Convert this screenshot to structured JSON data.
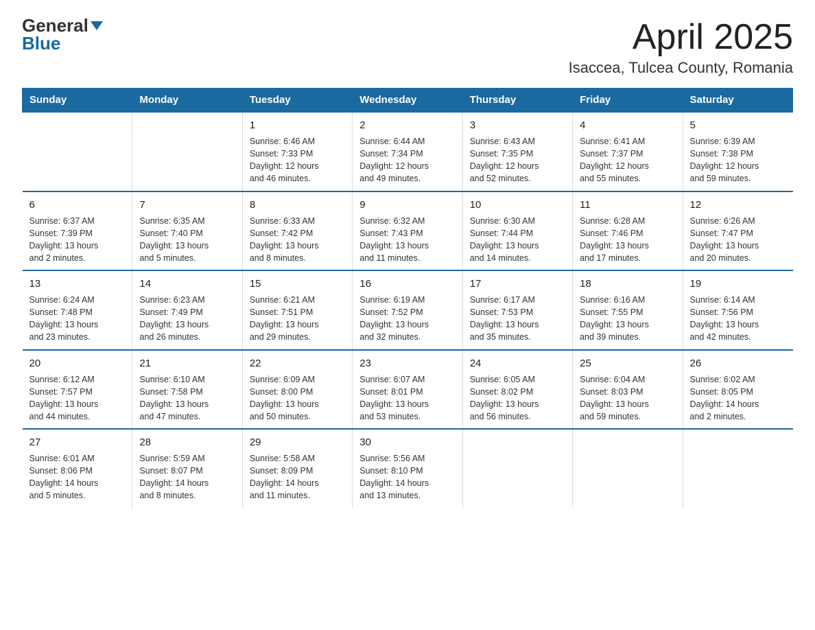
{
  "header": {
    "logo_line1": "General",
    "logo_line2": "Blue",
    "month_year": "April 2025",
    "location": "Isaccea, Tulcea County, Romania"
  },
  "days_of_week": [
    "Sunday",
    "Monday",
    "Tuesday",
    "Wednesday",
    "Thursday",
    "Friday",
    "Saturday"
  ],
  "weeks": [
    [
      {
        "day": "",
        "info": ""
      },
      {
        "day": "",
        "info": ""
      },
      {
        "day": "1",
        "info": "Sunrise: 6:46 AM\nSunset: 7:33 PM\nDaylight: 12 hours\nand 46 minutes."
      },
      {
        "day": "2",
        "info": "Sunrise: 6:44 AM\nSunset: 7:34 PM\nDaylight: 12 hours\nand 49 minutes."
      },
      {
        "day": "3",
        "info": "Sunrise: 6:43 AM\nSunset: 7:35 PM\nDaylight: 12 hours\nand 52 minutes."
      },
      {
        "day": "4",
        "info": "Sunrise: 6:41 AM\nSunset: 7:37 PM\nDaylight: 12 hours\nand 55 minutes."
      },
      {
        "day": "5",
        "info": "Sunrise: 6:39 AM\nSunset: 7:38 PM\nDaylight: 12 hours\nand 59 minutes."
      }
    ],
    [
      {
        "day": "6",
        "info": "Sunrise: 6:37 AM\nSunset: 7:39 PM\nDaylight: 13 hours\nand 2 minutes."
      },
      {
        "day": "7",
        "info": "Sunrise: 6:35 AM\nSunset: 7:40 PM\nDaylight: 13 hours\nand 5 minutes."
      },
      {
        "day": "8",
        "info": "Sunrise: 6:33 AM\nSunset: 7:42 PM\nDaylight: 13 hours\nand 8 minutes."
      },
      {
        "day": "9",
        "info": "Sunrise: 6:32 AM\nSunset: 7:43 PM\nDaylight: 13 hours\nand 11 minutes."
      },
      {
        "day": "10",
        "info": "Sunrise: 6:30 AM\nSunset: 7:44 PM\nDaylight: 13 hours\nand 14 minutes."
      },
      {
        "day": "11",
        "info": "Sunrise: 6:28 AM\nSunset: 7:46 PM\nDaylight: 13 hours\nand 17 minutes."
      },
      {
        "day": "12",
        "info": "Sunrise: 6:26 AM\nSunset: 7:47 PM\nDaylight: 13 hours\nand 20 minutes."
      }
    ],
    [
      {
        "day": "13",
        "info": "Sunrise: 6:24 AM\nSunset: 7:48 PM\nDaylight: 13 hours\nand 23 minutes."
      },
      {
        "day": "14",
        "info": "Sunrise: 6:23 AM\nSunset: 7:49 PM\nDaylight: 13 hours\nand 26 minutes."
      },
      {
        "day": "15",
        "info": "Sunrise: 6:21 AM\nSunset: 7:51 PM\nDaylight: 13 hours\nand 29 minutes."
      },
      {
        "day": "16",
        "info": "Sunrise: 6:19 AM\nSunset: 7:52 PM\nDaylight: 13 hours\nand 32 minutes."
      },
      {
        "day": "17",
        "info": "Sunrise: 6:17 AM\nSunset: 7:53 PM\nDaylight: 13 hours\nand 35 minutes."
      },
      {
        "day": "18",
        "info": "Sunrise: 6:16 AM\nSunset: 7:55 PM\nDaylight: 13 hours\nand 39 minutes."
      },
      {
        "day": "19",
        "info": "Sunrise: 6:14 AM\nSunset: 7:56 PM\nDaylight: 13 hours\nand 42 minutes."
      }
    ],
    [
      {
        "day": "20",
        "info": "Sunrise: 6:12 AM\nSunset: 7:57 PM\nDaylight: 13 hours\nand 44 minutes."
      },
      {
        "day": "21",
        "info": "Sunrise: 6:10 AM\nSunset: 7:58 PM\nDaylight: 13 hours\nand 47 minutes."
      },
      {
        "day": "22",
        "info": "Sunrise: 6:09 AM\nSunset: 8:00 PM\nDaylight: 13 hours\nand 50 minutes."
      },
      {
        "day": "23",
        "info": "Sunrise: 6:07 AM\nSunset: 8:01 PM\nDaylight: 13 hours\nand 53 minutes."
      },
      {
        "day": "24",
        "info": "Sunrise: 6:05 AM\nSunset: 8:02 PM\nDaylight: 13 hours\nand 56 minutes."
      },
      {
        "day": "25",
        "info": "Sunrise: 6:04 AM\nSunset: 8:03 PM\nDaylight: 13 hours\nand 59 minutes."
      },
      {
        "day": "26",
        "info": "Sunrise: 6:02 AM\nSunset: 8:05 PM\nDaylight: 14 hours\nand 2 minutes."
      }
    ],
    [
      {
        "day": "27",
        "info": "Sunrise: 6:01 AM\nSunset: 8:06 PM\nDaylight: 14 hours\nand 5 minutes."
      },
      {
        "day": "28",
        "info": "Sunrise: 5:59 AM\nSunset: 8:07 PM\nDaylight: 14 hours\nand 8 minutes."
      },
      {
        "day": "29",
        "info": "Sunrise: 5:58 AM\nSunset: 8:09 PM\nDaylight: 14 hours\nand 11 minutes."
      },
      {
        "day": "30",
        "info": "Sunrise: 5:56 AM\nSunset: 8:10 PM\nDaylight: 14 hours\nand 13 minutes."
      },
      {
        "day": "",
        "info": ""
      },
      {
        "day": "",
        "info": ""
      },
      {
        "day": "",
        "info": ""
      }
    ]
  ]
}
